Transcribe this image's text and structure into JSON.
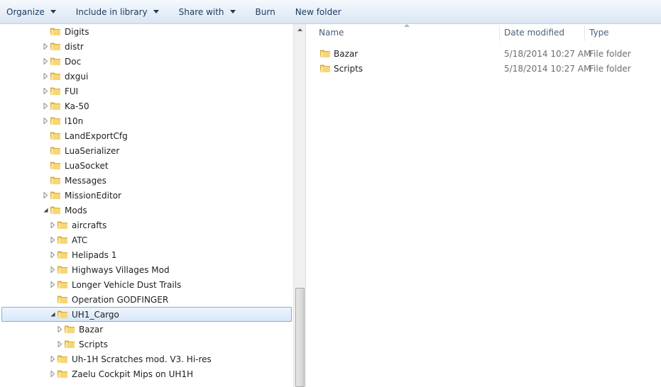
{
  "toolbar": {
    "organize": "Organize",
    "include": "Include in library",
    "share": "Share with",
    "burn": "Burn",
    "new_folder": "New folder"
  },
  "tree": [
    {
      "label": "Digits",
      "level": 0,
      "expander": "none",
      "icon": "folder-icon"
    },
    {
      "label": "distr",
      "level": 0,
      "expander": "closed",
      "icon": "folder-icon"
    },
    {
      "label": "Doc",
      "level": 0,
      "expander": "closed",
      "icon": "folder-icon"
    },
    {
      "label": "dxgui",
      "level": 0,
      "expander": "closed",
      "icon": "folder-icon"
    },
    {
      "label": "FUI",
      "level": 0,
      "expander": "closed",
      "icon": "folder-icon"
    },
    {
      "label": "Ka-50",
      "level": 0,
      "expander": "closed",
      "icon": "folder-icon"
    },
    {
      "label": "l10n",
      "level": 0,
      "expander": "closed",
      "icon": "folder-icon"
    },
    {
      "label": "LandExportCfg",
      "level": 0,
      "expander": "none",
      "icon": "folder-icon"
    },
    {
      "label": "LuaSerializer",
      "level": 0,
      "expander": "none",
      "icon": "folder-icon"
    },
    {
      "label": "LuaSocket",
      "level": 0,
      "expander": "none",
      "icon": "folder-icon"
    },
    {
      "label": "Messages",
      "level": 0,
      "expander": "none",
      "icon": "folder-icon"
    },
    {
      "label": "MissionEditor",
      "level": 0,
      "expander": "closed",
      "icon": "folder-icon"
    },
    {
      "label": "Mods",
      "level": 0,
      "expander": "open",
      "icon": "folder-icon"
    },
    {
      "label": "aircrafts",
      "level": 1,
      "expander": "closed",
      "icon": "folder-icon"
    },
    {
      "label": "ATC",
      "level": 1,
      "expander": "closed",
      "icon": "folder-icon"
    },
    {
      "label": "Helipads 1",
      "level": 1,
      "expander": "closed",
      "icon": "folder-icon"
    },
    {
      "label": "Highways Villages Mod",
      "level": 1,
      "expander": "closed",
      "icon": "folder-icon"
    },
    {
      "label": "Longer Vehicle Dust Trails",
      "level": 1,
      "expander": "closed",
      "icon": "folder-icon"
    },
    {
      "label": "Operation GODFINGER",
      "level": 1,
      "expander": "none",
      "icon": "folder-icon"
    },
    {
      "label": "UH1_Cargo",
      "level": 1,
      "expander": "open",
      "icon": "folder-icon",
      "selected": true
    },
    {
      "label": "Bazar",
      "level": 2,
      "expander": "closed",
      "icon": "folder-icon"
    },
    {
      "label": "Scripts",
      "level": 2,
      "expander": "closed",
      "icon": "folder-icon"
    },
    {
      "label": "Uh-1H Scratches mod. V3. Hi-res",
      "level": 1,
      "expander": "closed",
      "icon": "folder-icon"
    },
    {
      "label": "Zaelu Cockpit Mips on UH1H",
      "level": 1,
      "expander": "closed",
      "icon": "folder-icon"
    }
  ],
  "columns": {
    "name": "Name",
    "date": "Date modified",
    "type": "Type"
  },
  "files": [
    {
      "name": "Bazar",
      "date": "5/18/2014 10:27 AM",
      "type": "File folder"
    },
    {
      "name": "Scripts",
      "date": "5/18/2014 10:27 AM",
      "type": "File folder"
    }
  ],
  "colors": {
    "selection_border": "#84acdd",
    "toolbar_text": "#1e395b",
    "folder": "#e8c25a"
  }
}
